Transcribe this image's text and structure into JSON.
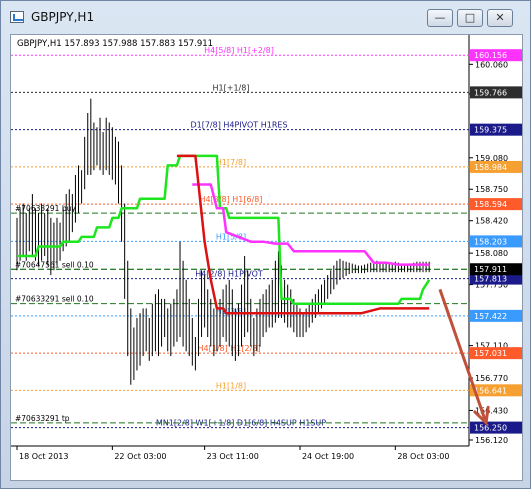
{
  "window": {
    "title": "GBPJPY,H1",
    "controls": {
      "minimize": "—",
      "maximize": "□",
      "close": "✕"
    }
  },
  "chart_header": "GBPJPY,H1  157.893 157.988 157.883 157.911",
  "colors": {
    "price_bars": "#000000",
    "green_line": "#1ee61e",
    "magenta_line": "#ff33ff",
    "red_line": "#dd1111",
    "arrow": "#c0503a",
    "current_price_bg": "#000000",
    "level_magenta": "#ff33ff",
    "level_dark": "#2d2d2d",
    "level_navy": "#1a1a8a",
    "level_orange": "#f5a030",
    "level_red": "#ff5a2a",
    "level_blue": "#3a9bff",
    "level_green": "#1f7a1f"
  },
  "chart_data": {
    "type": "line",
    "symbol": "GBPJPY",
    "timeframe": "H1",
    "ylim": [
      156.12,
      160.2
    ],
    "x_ticks": [
      "18 Oct 2013",
      "22 Oct 03:00",
      "23 Oct 11:00",
      "24 Oct 19:00",
      "28 Oct 03:00"
    ],
    "y_ticks": [
      156.12,
      156.43,
      156.77,
      157.11,
      157.75,
      158.08,
      158.42,
      158.75,
      159.08,
      159.75,
      160.06
    ],
    "levels": [
      {
        "name": "H4[5/8] H1[+2/8]",
        "price": 160.156,
        "price_label": "160.156",
        "color": "#ff33ff",
        "style": "dash"
      },
      {
        "name": "H1[+1/8]",
        "price": 159.766,
        "price_label": "159.766",
        "color": "#2d2d2d",
        "style": "dash"
      },
      {
        "name": "D1[7/8] H4PIVOT H1RES",
        "price": 159.375,
        "price_label": "159.375",
        "color": "#1a1a8a",
        "style": "dash"
      },
      {
        "name": "H1[7/8]",
        "price": 158.984,
        "price_label": "158.984",
        "color": "#f5a030",
        "style": "dash"
      },
      {
        "name": "H4[3/8] H1[6/8]",
        "price": 158.594,
        "price_label": "158.594",
        "color": "#ff5a2a",
        "style": "dash"
      },
      {
        "name": "H1[5/8]",
        "price": 158.203,
        "price_label": "158.203",
        "color": "#3a9bff",
        "style": "dash"
      },
      {
        "name": "H4[2/8] H1PIVOT",
        "price": 157.813,
        "price_label": "157.813",
        "color": "#1a1a8a",
        "style": "dash"
      },
      {
        "name": "H1[3/8]",
        "price": 157.422,
        "price_label": "157.422",
        "color": "#3a9bff",
        "style": "dash"
      },
      {
        "name": "H4[1/8] H1[2/8]",
        "price": 157.031,
        "price_label": "157.031",
        "color": "#ff5a2a",
        "style": "dash"
      },
      {
        "name": "H1[1/8]",
        "price": 156.641,
        "price_label": "156.641",
        "color": "#f5a030",
        "style": "dash"
      },
      {
        "name": "MN1[2/8] W1[+1/8] D1[6/8] H4SUP H1SUP",
        "price": 156.25,
        "price_label": "156.250",
        "color": "#1a1a8a",
        "style": "dash"
      }
    ],
    "current_price": {
      "price": 157.911,
      "label": "157.911"
    },
    "orders": [
      {
        "label": "#70633291 buy",
        "price": 158.5
      },
      {
        "label": "#70647561 sell 0.10",
        "price": 157.91
      },
      {
        "label": "#70633291 sell 0.10",
        "price": 157.55
      },
      {
        "label": "#70633291 tp",
        "price": 156.3
      }
    ],
    "series": [
      {
        "name": "",
        "kind": "bars",
        "x": [
          0,
          2,
          4,
          6,
          8,
          10,
          12,
          14,
          16,
          18,
          20,
          22,
          24,
          26,
          28,
          30,
          32,
          34,
          36,
          38,
          40,
          42,
          44,
          46,
          48,
          50,
          52,
          54,
          56,
          58,
          60,
          62,
          64,
          66,
          68,
          70,
          72,
          74,
          76,
          78,
          80,
          82,
          84,
          86,
          88,
          90,
          92,
          94,
          96,
          98,
          100,
          102,
          104,
          106,
          108,
          110,
          112,
          114,
          116,
          118,
          120,
          122,
          124,
          126,
          128,
          130,
          132,
          134,
          136,
          138,
          140,
          142,
          144,
          146,
          148,
          150,
          152,
          154,
          156,
          158,
          160,
          162,
          164,
          166,
          168,
          170,
          172,
          174,
          176,
          178,
          180,
          182,
          184,
          186,
          188,
          190,
          192,
          194,
          196,
          198,
          200,
          202,
          204,
          206,
          208,
          210,
          212,
          214,
          216,
          218,
          220,
          222,
          224,
          226,
          228,
          230,
          232,
          234,
          236,
          238,
          240,
          242,
          244,
          246,
          248,
          250,
          252,
          254,
          256,
          258,
          260,
          262,
          264,
          266,
          268
        ],
        "high": [
          158.45,
          158.55,
          158.6,
          158.5,
          158.55,
          158.7,
          158.55,
          158.5,
          158.6,
          158.5,
          158.55,
          158.45,
          158.4,
          158.45,
          158.4,
          158.55,
          158.7,
          158.75,
          158.7,
          158.9,
          159.0,
          158.95,
          159.3,
          159.55,
          159.7,
          159.45,
          159.4,
          159.5,
          159.35,
          159.5,
          159.45,
          159.4,
          159.3,
          159.25,
          159.0,
          158.6,
          158.0,
          157.5,
          157.3,
          157.4,
          157.45,
          157.5,
          157.5,
          157.4,
          157.55,
          157.65,
          157.7,
          157.6,
          157.6,
          157.5,
          157.55,
          157.6,
          157.7,
          158.2,
          158.0,
          157.8,
          157.6,
          157.4,
          157.2,
          157.6,
          157.9,
          157.85,
          157.7,
          157.6,
          157.5,
          157.5,
          157.6,
          157.7,
          157.75,
          157.8,
          157.7,
          157.5,
          157.55,
          157.75,
          158.05,
          157.9,
          157.6,
          157.4,
          157.5,
          157.6,
          157.65,
          157.7,
          157.75,
          157.8,
          158.0,
          158.1,
          157.95,
          157.8,
          157.75,
          157.7,
          157.6,
          157.55,
          157.5,
          157.45,
          157.5,
          157.55,
          157.6,
          157.65,
          157.7,
          157.75,
          157.8,
          157.85,
          157.9,
          157.95,
          158.0,
          158.02,
          158.0,
          157.99,
          157.98,
          157.97,
          157.96,
          157.95,
          157.95,
          157.96,
          157.97,
          157.98,
          157.99,
          158.0,
          157.99,
          157.98,
          157.97,
          157.97,
          157.98,
          157.99,
          157.98,
          157.97,
          157.96,
          157.96,
          157.97,
          157.98,
          157.99,
          157.99,
          157.99,
          157.99,
          157.99
        ],
        "low": [
          157.9,
          158.0,
          158.05,
          158.0,
          158.1,
          158.05,
          158.0,
          157.95,
          158.0,
          158.05,
          157.95,
          157.85,
          157.9,
          157.95,
          158.0,
          158.1,
          158.15,
          158.2,
          158.3,
          158.4,
          158.5,
          158.6,
          158.75,
          158.9,
          158.9,
          158.95,
          159.0,
          158.95,
          158.9,
          158.95,
          158.9,
          158.85,
          158.8,
          158.6,
          158.2,
          157.6,
          157.0,
          156.7,
          156.75,
          156.85,
          156.9,
          157.0,
          157.05,
          156.95,
          157.0,
          157.05,
          157.0,
          157.1,
          157.2,
          157.05,
          157.0,
          157.1,
          157.15,
          157.2,
          157.1,
          157.05,
          157.0,
          156.9,
          156.85,
          157.0,
          157.2,
          157.3,
          157.2,
          157.1,
          157.0,
          157.05,
          157.1,
          157.2,
          157.15,
          157.1,
          157.0,
          156.95,
          157.0,
          157.1,
          157.2,
          157.25,
          157.1,
          157.0,
          157.05,
          157.1,
          157.2,
          157.25,
          157.3,
          157.3,
          157.35,
          157.4,
          157.4,
          157.35,
          157.3,
          157.3,
          157.25,
          157.2,
          157.2,
          157.2,
          157.25,
          157.3,
          157.35,
          157.4,
          157.45,
          157.5,
          157.55,
          157.6,
          157.65,
          157.7,
          157.75,
          157.8,
          157.82,
          157.84,
          157.86,
          157.87,
          157.87,
          157.87,
          157.87,
          157.87,
          157.88,
          157.88,
          157.88,
          157.88,
          157.88,
          157.88,
          157.88,
          157.88,
          157.88,
          157.88,
          157.88,
          157.88,
          157.88,
          157.88,
          157.88,
          157.88,
          157.88,
          157.88,
          157.88,
          157.88,
          157.88
        ]
      },
      {
        "name": "",
        "kind": "line",
        "color": "#1ee61e",
        "x": [
          0,
          12,
          14,
          28,
          30,
          40,
          42,
          50,
          52,
          60,
          62,
          66,
          68,
          78,
          80,
          96,
          98,
          104,
          106,
          112,
          114,
          130,
          132,
          136,
          138,
          170,
          172,
          178,
          180,
          212,
          214,
          230,
          232,
          248,
          250,
          262,
          264,
          268
        ],
        "y": [
          158.05,
          158.05,
          158.15,
          158.15,
          158.2,
          158.2,
          158.25,
          158.25,
          158.35,
          158.35,
          158.45,
          158.45,
          158.55,
          158.55,
          158.65,
          158.65,
          159.0,
          159.0,
          159.1,
          159.1,
          159.1,
          159.1,
          158.55,
          158.55,
          158.45,
          158.45,
          157.6,
          157.6,
          157.55,
          157.55,
          157.55,
          157.55,
          157.55,
          157.55,
          157.6,
          157.6,
          157.7,
          157.8
        ]
      },
      {
        "name": "",
        "kind": "line",
        "color": "#ff33ff",
        "x": [
          114,
          118,
          122,
          126,
          130,
          134,
          136,
          144,
          152,
          160,
          168,
          176,
          180,
          196,
          214,
          226,
          232,
          240,
          248,
          256,
          262,
          264,
          268
        ],
        "y": [
          158.8,
          158.8,
          158.8,
          158.8,
          158.55,
          158.55,
          158.3,
          158.25,
          158.2,
          158.2,
          158.18,
          158.18,
          158.1,
          158.1,
          158.1,
          158.1,
          157.98,
          157.98,
          157.96,
          157.96,
          157.96,
          157.96,
          157.96
        ]
      },
      {
        "name": "",
        "kind": "line",
        "color": "#dd1111",
        "x": [
          104,
          110,
          116,
          118,
          122,
          126,
          130,
          134,
          136,
          140,
          148,
          154,
          164,
          180,
          210,
          224,
          236,
          248,
          268
        ],
        "y": [
          159.1,
          159.1,
          159.1,
          158.8,
          158.2,
          157.8,
          157.5,
          157.5,
          157.45,
          157.45,
          157.45,
          157.45,
          157.45,
          157.45,
          157.45,
          157.45,
          157.5,
          157.5,
          157.5
        ]
      }
    ],
    "annotations": [
      {
        "text": "",
        "kind": "arrow",
        "from": [
          275,
          157.7
        ],
        "to": [
          305,
          156.3
        ]
      }
    ]
  }
}
